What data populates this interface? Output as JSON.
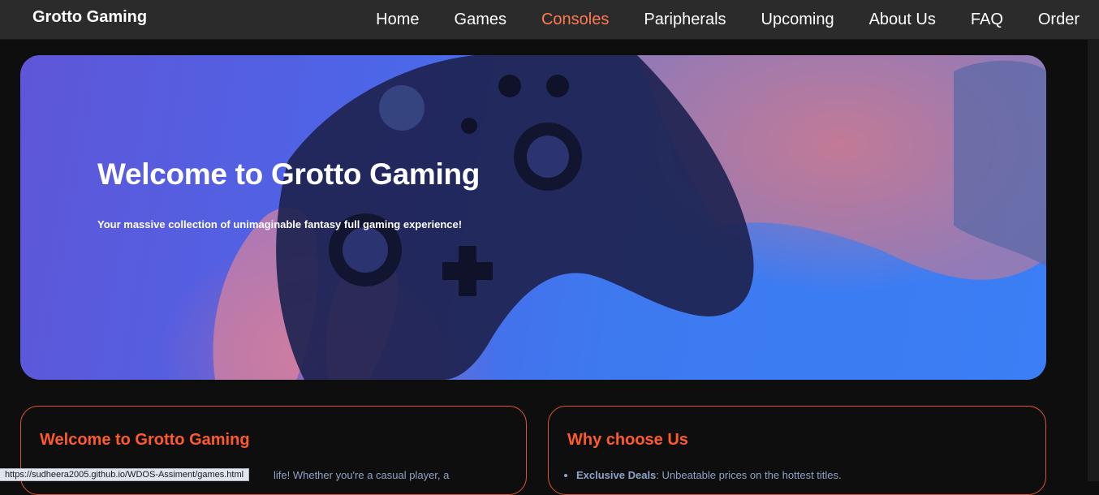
{
  "header": {
    "brand": "Grotto Gaming",
    "nav": [
      {
        "label": "Home",
        "active": false
      },
      {
        "label": "Games",
        "active": false
      },
      {
        "label": "Consoles",
        "active": true
      },
      {
        "label": "Paripherals",
        "active": false
      },
      {
        "label": "Upcoming",
        "active": false
      },
      {
        "label": "About Us",
        "active": false
      },
      {
        "label": "FAQ",
        "active": false
      },
      {
        "label": "Order",
        "active": false
      }
    ]
  },
  "hero": {
    "title": "Welcome to Grotto Gaming",
    "subtitle": "Your massive collection of unimaginable fantasy full gaming experience!"
  },
  "welcome_card": {
    "title": "Welcome to Grotto Gaming",
    "text": "life! Whether you're a casual player, a"
  },
  "why_card": {
    "title": "Why choose Us",
    "items": [
      {
        "strong": "Exclusive Deals",
        "rest": ": Unbeatable prices on the hottest titles."
      }
    ]
  },
  "status_bar": {
    "url": "https://sudheera2005.github.io/WDOS-Assiment/games.html"
  },
  "colors": {
    "accent": "#ff5a2c",
    "nav_active": "#ff7a52",
    "card_border": "#d9562e",
    "background": "#0f0e0e",
    "navbar": "#2b2b2b"
  },
  "icons": {
    "hero_image": "gamepad-icon"
  }
}
